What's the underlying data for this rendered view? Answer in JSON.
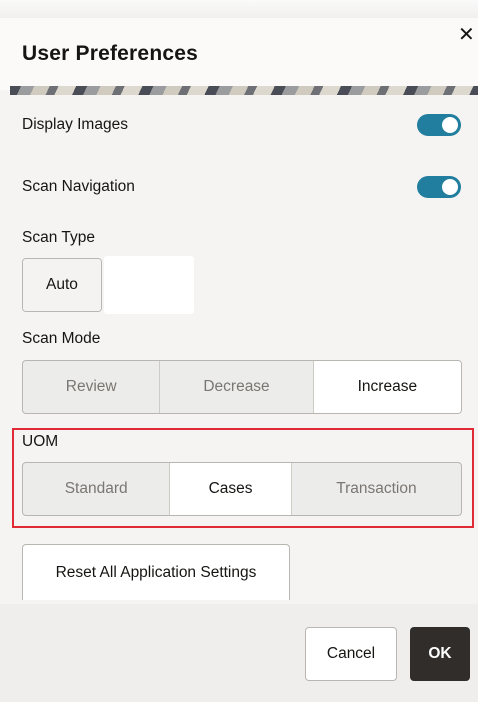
{
  "dialog": {
    "title": "User Preferences",
    "close_icon": "close-icon"
  },
  "display_images": {
    "label": "Display Images",
    "enabled": true
  },
  "scan_navigation": {
    "label": "Scan Navigation",
    "enabled": true
  },
  "scan_type": {
    "label": "Scan Type",
    "value": "Auto"
  },
  "scan_mode": {
    "label": "Scan Mode",
    "options": [
      "Review",
      "Decrease",
      "Increase"
    ],
    "selected": "Increase"
  },
  "uom": {
    "label": "UOM",
    "options": [
      "Standard",
      "Cases",
      "Transaction"
    ],
    "selected": "Cases",
    "highlight_color": "#e02b36"
  },
  "reset_button": {
    "label": "Reset All Application Settings"
  },
  "footer": {
    "cancel_label": "Cancel",
    "ok_label": "OK"
  },
  "colors": {
    "toggle_on": "#227e9e",
    "primary_button": "#312d2a"
  }
}
